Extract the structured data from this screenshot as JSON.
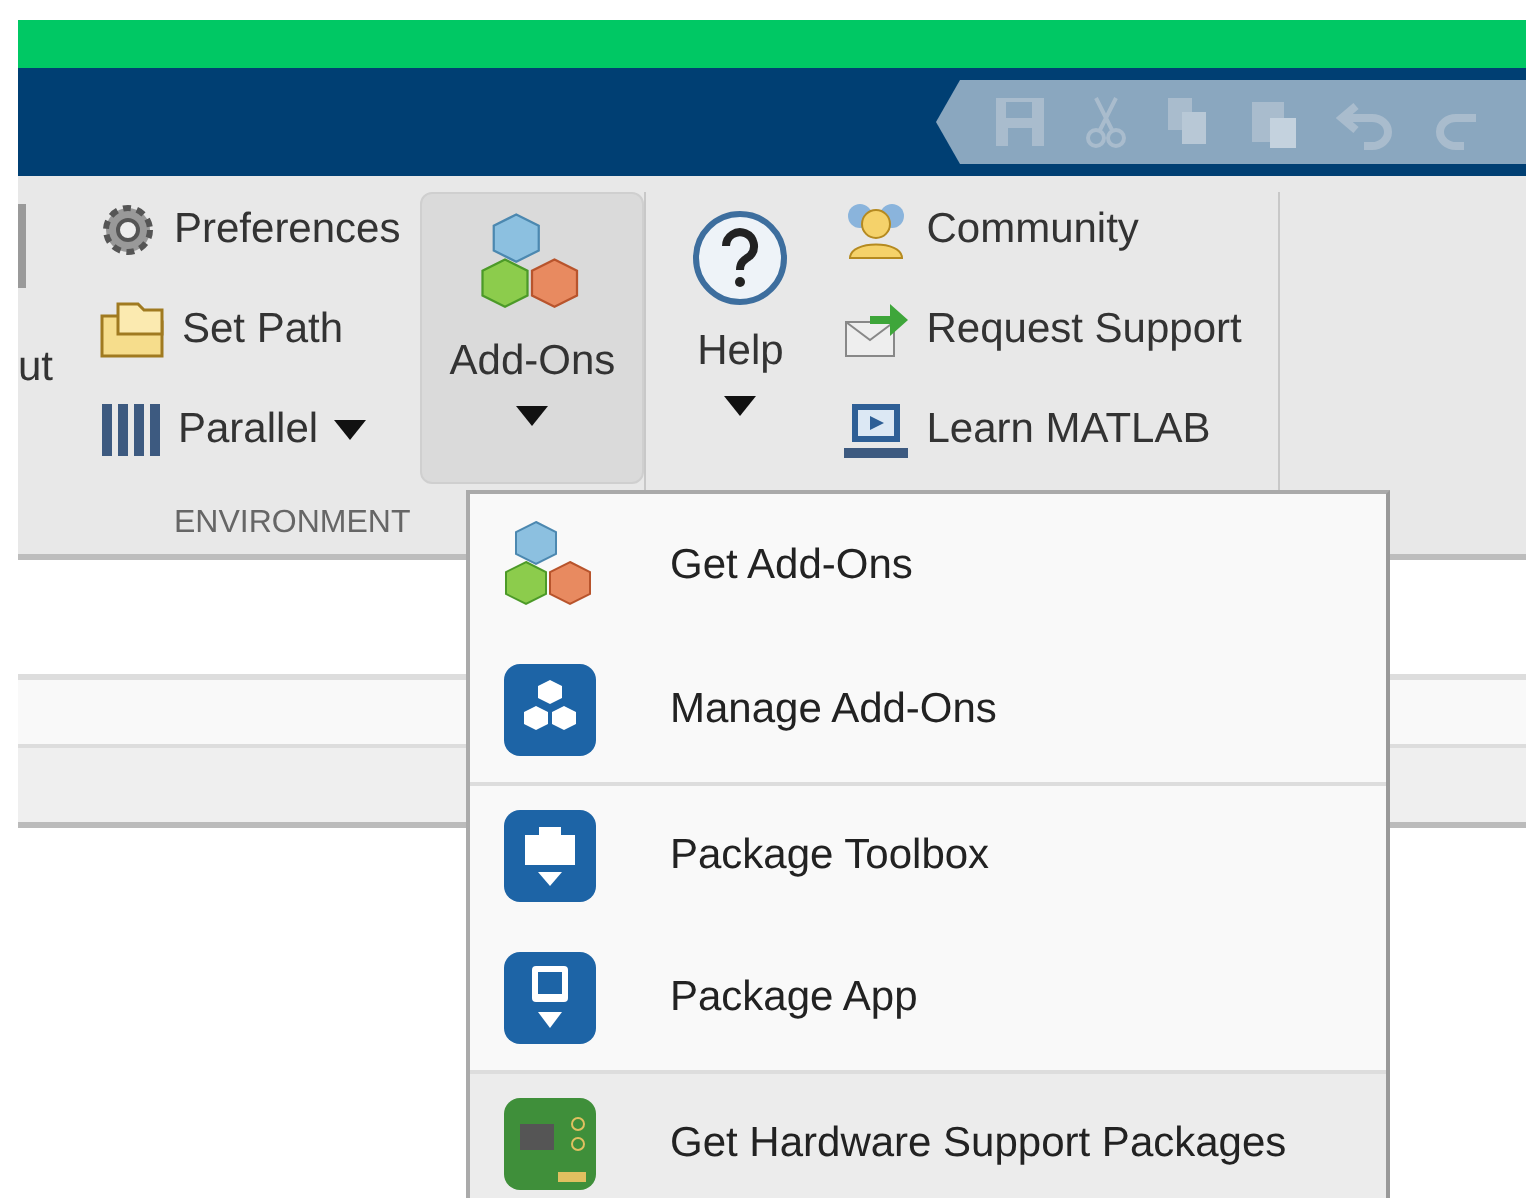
{
  "ribbon": {
    "cut_label": "ut",
    "environment": {
      "items": [
        {
          "kind": "gear",
          "label": "Preferences",
          "dropdown": false
        },
        {
          "kind": "folder",
          "label": "Set Path",
          "dropdown": false
        },
        {
          "kind": "bars",
          "label": "Parallel",
          "dropdown": true
        }
      ],
      "section_label": "ENVIRONMENT"
    },
    "addons_button": {
      "label": "Add-Ons",
      "pressed": true
    },
    "help_button": {
      "label": "Help"
    },
    "resources": [
      {
        "kind": "people",
        "label": "Community"
      },
      {
        "kind": "mail",
        "label": "Request Support"
      },
      {
        "kind": "screen",
        "label": "Learn MATLAB"
      }
    ]
  },
  "addons_menu": [
    {
      "kind": "cubes",
      "label": "Get Add-Ons",
      "divider_above": false,
      "selected": false
    },
    {
      "kind": "manage",
      "label": "Manage Add-Ons",
      "divider_above": false,
      "selected": false
    },
    {
      "kind": "toolbox",
      "label": "Package Toolbox",
      "divider_above": true,
      "selected": false
    },
    {
      "kind": "app",
      "label": "Package App",
      "divider_above": false,
      "selected": false
    },
    {
      "kind": "board",
      "label": "Get Hardware Support Packages",
      "divider_above": true,
      "selected": true
    }
  ]
}
